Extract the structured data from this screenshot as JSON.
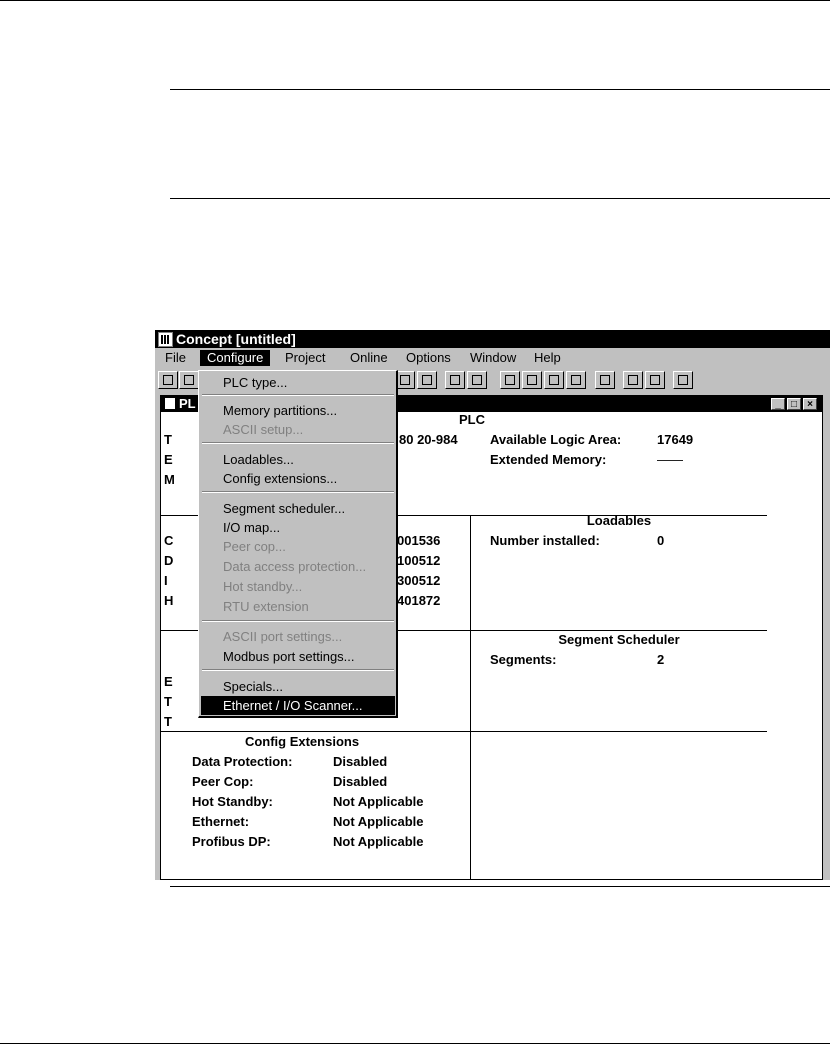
{
  "app": {
    "title": "Concept [untitled]"
  },
  "menubar": [
    "File",
    "Configure",
    "Project",
    "Online",
    "Options",
    "Window",
    "Help"
  ],
  "configure_menu": {
    "items": [
      "PLC type...",
      "Memory partitions...",
      "ASCII setup...",
      "Loadables...",
      "Config extensions...",
      "Segment scheduler...",
      "I/O map...",
      "Peer cop...",
      "Data access protection...",
      "Hot standby...",
      "RTU extension",
      "ASCII port settings...",
      "Modbus port settings...",
      "Specials...",
      "Ethernet / I/O Scanner..."
    ]
  },
  "child_window": {
    "title": "PL"
  },
  "plc": {
    "heading": "PLC",
    "left_fragment": [
      "T",
      "E",
      "M"
    ],
    "type_value_fragment": "80 20-984",
    "right_labels": [
      "Available Logic Area:",
      "Extended Memory:"
    ],
    "right_values": [
      "17649",
      "——"
    ]
  },
  "memory": {
    "left_fragment": [
      "C",
      "D",
      "I",
      "H"
    ],
    "values_fragment": [
      "001536",
      "100512",
      "300512",
      "401872"
    ]
  },
  "loadables": {
    "heading": "Loadables",
    "label": "Number installed:",
    "value": "0"
  },
  "specials_fragment": [
    "E",
    "T",
    "T"
  ],
  "segment_scheduler": {
    "heading": "Segment Scheduler",
    "label": "Segments:",
    "value": "2"
  },
  "config_extensions": {
    "heading": "Config Extensions",
    "labels": [
      "Data Protection:",
      "Peer Cop:",
      "Hot Standby:",
      "Ethernet:",
      "Profibus DP:"
    ],
    "values": [
      "Disabled",
      "Disabled",
      "Not Applicable",
      "Not Applicable",
      "Not Applicable"
    ]
  }
}
